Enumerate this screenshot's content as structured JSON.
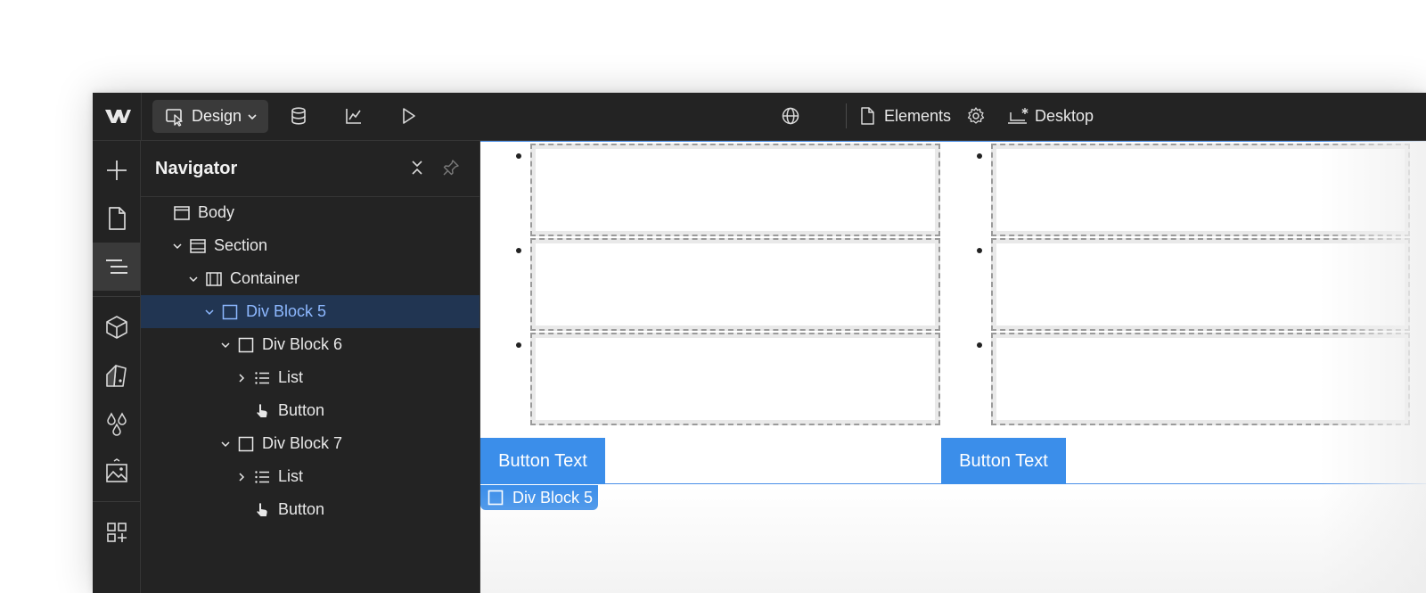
{
  "topbar": {
    "mode_label": "Design",
    "page_label": "Elements",
    "breakpoint_label": "Desktop",
    "icons": [
      "webflow-logo-icon",
      "design-cursor-icon",
      "chevron-down-icon",
      "database-icon",
      "analytics-icon",
      "preview-play-icon",
      "globe-icon",
      "page-icon",
      "settings-gear-icon",
      "desktop-breakpoint-icon"
    ]
  },
  "rail": {
    "icons": [
      "add-plus-icon",
      "pages-icon",
      "navigator-icon",
      "components-cube-icon",
      "style-selector-icon",
      "variables-drops-icon",
      "assets-image-icon",
      "apps-icon"
    ],
    "active": "navigator-icon"
  },
  "navigator": {
    "title": "Navigator",
    "tree": [
      {
        "label": "Body",
        "depth": 0,
        "caret": "none",
        "icon": "body-icon"
      },
      {
        "label": "Section",
        "depth": 1,
        "caret": "down",
        "icon": "section-icon"
      },
      {
        "label": "Container",
        "depth": 2,
        "caret": "down",
        "icon": "container-icon"
      },
      {
        "label": "Div Block 5",
        "depth": 3,
        "caret": "down",
        "icon": "div-block-icon",
        "selected": true
      },
      {
        "label": "Div Block 6",
        "depth": 4,
        "caret": "down",
        "icon": "div-block-icon"
      },
      {
        "label": "List",
        "depth": 5,
        "caret": "right",
        "icon": "list-icon"
      },
      {
        "label": "Button",
        "depth": 5,
        "caret": "none",
        "icon": "button-hand-icon"
      },
      {
        "label": "Div Block 7",
        "depth": 4,
        "caret": "down",
        "icon": "div-block-icon"
      },
      {
        "label": "List",
        "depth": 5,
        "caret": "right",
        "icon": "list-icon"
      },
      {
        "label": "Button",
        "depth": 5,
        "caret": "none",
        "icon": "button-hand-icon"
      }
    ]
  },
  "canvas": {
    "columns": [
      {
        "list_items": 3,
        "button_label": "Button Text"
      },
      {
        "list_items": 3,
        "button_label": "Button Text"
      }
    ],
    "selection_tag": "Div Block 5"
  },
  "colors": {
    "accent": "#3b8eea",
    "selected_row_bg": "#213552",
    "selected_row_text": "#8db8ff",
    "panel_bg": "#232323"
  }
}
